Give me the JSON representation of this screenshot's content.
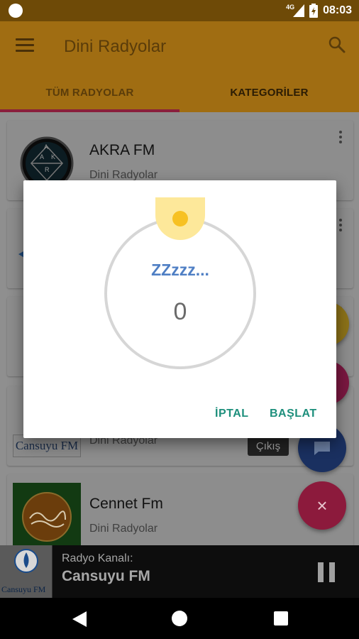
{
  "status_bar": {
    "network": "4G",
    "time": "08:03"
  },
  "app_bar": {
    "title": "Dini Radyolar",
    "menu_icon": "menu-icon",
    "search_icon": "search-icon"
  },
  "tabs": [
    {
      "label": "TÜM RADYOLAR",
      "selected": true
    },
    {
      "label": "KATEGORİLER",
      "selected": false
    }
  ],
  "stations": [
    {
      "name": "AKRA FM",
      "category": "Dini Radyolar",
      "logo_text": "A K R"
    },
    {
      "name": "",
      "category": "",
      "logo_text": ""
    },
    {
      "name": "",
      "category": "",
      "logo_text": ""
    },
    {
      "name": "",
      "category": "Dini Radyolar",
      "logo_text": "Cansuyu FM"
    },
    {
      "name": "Cennet Fm",
      "category": "Dini Radyolar",
      "logo_text": ""
    }
  ],
  "floating": {
    "exit_label": "Çıkış",
    "close_symbol": "×"
  },
  "dialog": {
    "status_text": "ZZzzz...",
    "timer_value": "0",
    "cancel_label": "İPTAL",
    "start_label": "BAŞLAT"
  },
  "now_playing": {
    "label": "Radyo Kanalı:",
    "title": "Cansuyu FM",
    "logo_text": "Cansuyu FM"
  },
  "colors": {
    "primary": "#a06d12",
    "accent": "#8a1f3c",
    "dialog_button": "#1d8f7c",
    "sleep_text": "#4f7fc4",
    "knob": "#f7c123"
  }
}
